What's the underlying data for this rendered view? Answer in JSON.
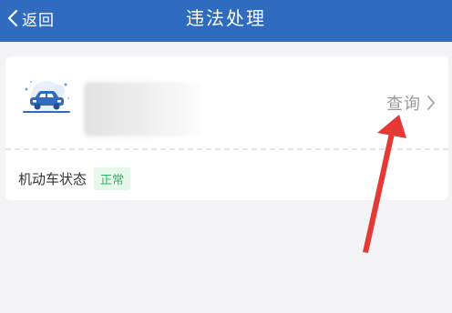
{
  "header": {
    "back_label": "返回",
    "title": "违法处理",
    "background_color": "#2f6cc0"
  },
  "vehicle_card": {
    "query_label": "查询",
    "status_label": "机动车状态",
    "status_value": "正常",
    "status_color": "#3ab06a",
    "icons": [
      "car-icon",
      "chevron-right-icon"
    ]
  },
  "annotation": {
    "type": "red-arrow",
    "color": "#e53935",
    "points_to": "query-button"
  }
}
